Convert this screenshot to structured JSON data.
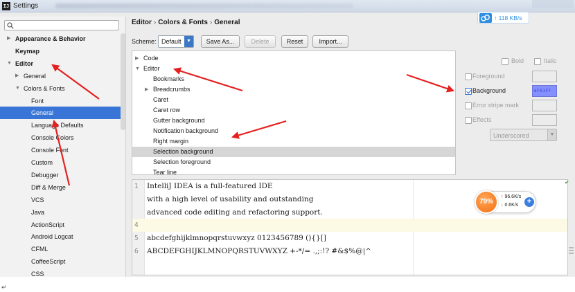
{
  "window": {
    "title": "Settings",
    "app_icon_text": "IJ"
  },
  "speed_badge": {
    "text": "118 KB/s",
    "arrow": "↑"
  },
  "search": {
    "placeholder": ""
  },
  "sidebar": {
    "items": [
      {
        "label": "Appearance & Behavior",
        "level": 0,
        "bold": true,
        "arrow": "▶",
        "selected": false
      },
      {
        "label": "Keymap",
        "level": 0,
        "bold": true,
        "arrow": "",
        "selected": false
      },
      {
        "label": "Editor",
        "level": 0,
        "bold": true,
        "arrow": "▼",
        "selected": false
      },
      {
        "label": "General",
        "level": 1,
        "bold": false,
        "arrow": "▶",
        "selected": false
      },
      {
        "label": "Colors & Fonts",
        "level": 1,
        "bold": false,
        "arrow": "▼",
        "selected": false
      },
      {
        "label": "Font",
        "level": 2,
        "bold": false,
        "arrow": "",
        "selected": false
      },
      {
        "label": "General",
        "level": 2,
        "bold": false,
        "arrow": "",
        "selected": true
      },
      {
        "label": "Language Defaults",
        "level": 2,
        "bold": false,
        "arrow": "",
        "selected": false
      },
      {
        "label": "Console Colors",
        "level": 2,
        "bold": false,
        "arrow": "",
        "selected": false
      },
      {
        "label": "Console Font",
        "level": 2,
        "bold": false,
        "arrow": "",
        "selected": false
      },
      {
        "label": "Custom",
        "level": 2,
        "bold": false,
        "arrow": "",
        "selected": false
      },
      {
        "label": "Debugger",
        "level": 2,
        "bold": false,
        "arrow": "",
        "selected": false
      },
      {
        "label": "Diff & Merge",
        "level": 2,
        "bold": false,
        "arrow": "",
        "selected": false
      },
      {
        "label": "VCS",
        "level": 2,
        "bold": false,
        "arrow": "",
        "selected": false
      },
      {
        "label": "Java",
        "level": 2,
        "bold": false,
        "arrow": "",
        "selected": false
      },
      {
        "label": "ActionScript",
        "level": 2,
        "bold": false,
        "arrow": "",
        "selected": false
      },
      {
        "label": "Android Logcat",
        "level": 2,
        "bold": false,
        "arrow": "",
        "selected": false
      },
      {
        "label": "CFML",
        "level": 2,
        "bold": false,
        "arrow": "",
        "selected": false
      },
      {
        "label": "CoffeeScript",
        "level": 2,
        "bold": false,
        "arrow": "",
        "selected": false
      },
      {
        "label": "CSS",
        "level": 2,
        "bold": false,
        "arrow": "",
        "selected": false
      }
    ]
  },
  "breadcrumb": {
    "parts": [
      "Editor",
      "Colors & Fonts",
      "General"
    ],
    "separator": "›"
  },
  "toolbar": {
    "scheme_label": "Scheme:",
    "scheme_value": "Default",
    "save_as_label": "Save As...",
    "delete_label": "Delete",
    "reset_label": "Reset",
    "import_label": "Import..."
  },
  "attributes": {
    "items": [
      {
        "label": "Code",
        "level": 0,
        "arrow": "▶",
        "selected": false
      },
      {
        "label": "Editor",
        "level": 0,
        "arrow": "▼",
        "selected": false
      },
      {
        "label": "Bookmarks",
        "level": 1,
        "arrow": "",
        "selected": false
      },
      {
        "label": "Breadcrumbs",
        "level": 1,
        "arrow": "▶",
        "selected": false
      },
      {
        "label": "Caret",
        "level": 1,
        "arrow": "",
        "selected": false
      },
      {
        "label": "Caret row",
        "level": 1,
        "arrow": "",
        "selected": false
      },
      {
        "label": "Gutter background",
        "level": 1,
        "arrow": "",
        "selected": false
      },
      {
        "label": "Notification background",
        "level": 1,
        "arrow": "",
        "selected": false
      },
      {
        "label": "Right margin",
        "level": 1,
        "arrow": "",
        "selected": false
      },
      {
        "label": "Selection background",
        "level": 1,
        "arrow": "",
        "selected": true
      },
      {
        "label": "Selection foreground",
        "level": 1,
        "arrow": "",
        "selected": false
      },
      {
        "label": "Tear line",
        "level": 1,
        "arrow": "",
        "selected": false
      }
    ]
  },
  "properties": {
    "bold_label": "Bold",
    "italic_label": "Italic",
    "foreground_label": "Foreground",
    "background_label": "Background",
    "background_checked": true,
    "background_color_text": "6F81FF",
    "background_color": "#8590ff",
    "error_stripe_label": "Error stripe mark",
    "effects_label": "Effects",
    "effect_type": "Underscored"
  },
  "preview": {
    "lines": [
      {
        "num": "1",
        "text": "IntelliJ IDEA is a full-featured IDE",
        "mono": false
      },
      {
        "num": "",
        "text": "with a high level of usability and outstanding",
        "mono": false
      },
      {
        "num": "",
        "text": "advanced code editing and refactoring support.",
        "mono": false
      },
      {
        "num": "4",
        "text": "",
        "mono": false
      },
      {
        "num": "5",
        "text": "abcdefghijklmnopqrstuvwxyz 0123456789 (){}[]",
        "mono": false
      },
      {
        "num": "6",
        "text": "ABCDEFGHIJKLMNOPQRSTUVWXYZ +-*/= .,;:!? #&$%@|^",
        "mono": false
      },
      {
        "num": "",
        "text": "",
        "mono": false
      }
    ]
  },
  "net_widget": {
    "percent": "79%",
    "up": "96.6K/s",
    "down": "0.6K/s",
    "plus": "+"
  },
  "footer_mark": "↵",
  "colors": {
    "selection_blue": "#3875d7",
    "annotation_red": "#e52020",
    "background_swatch": "#8590ff"
  }
}
